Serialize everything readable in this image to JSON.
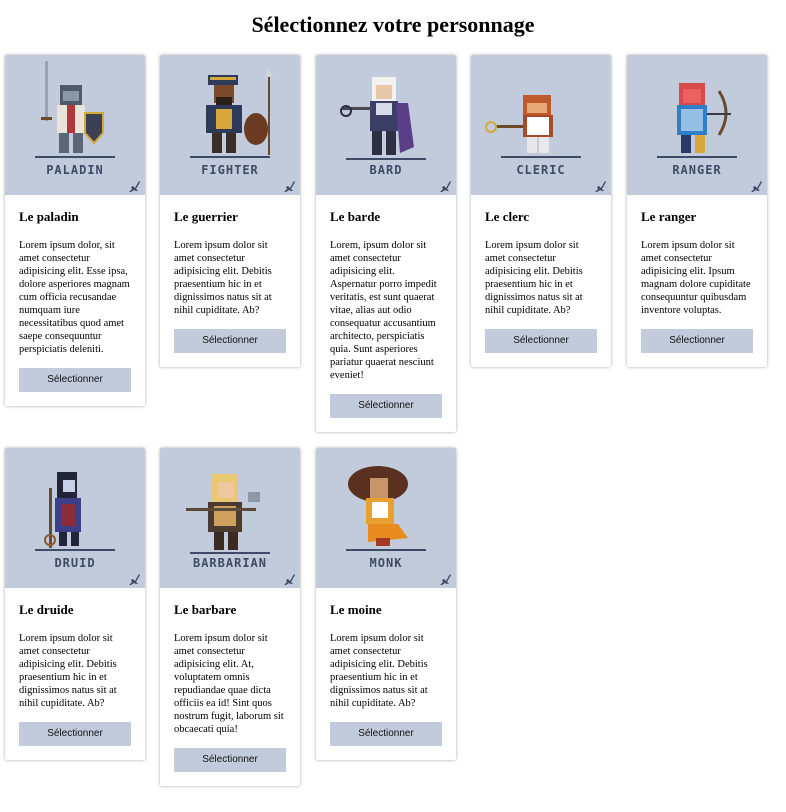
{
  "page": {
    "title": "Sélectionnez votre personnage"
  },
  "colors": {
    "art_bg": "#c2cbdb",
    "button_bg": "#c2cbdb",
    "accent": "#3f4a66"
  },
  "cards": [
    {
      "class_label": "PALADIN",
      "title": "Le paladin",
      "description": "Lorem ipsum dolor, sit amet consectetur adipisicing elit. Esse ipsa, dolore asperiores magnam cum officia recusandae numquam iure necessitatibus quod amet saepe consequuntur perspiciatis deleniti.",
      "button": "Sélectionner",
      "icon": "paladin-figure-icon"
    },
    {
      "class_label": "FIGHTER",
      "title": "Le guerrier",
      "description": "Lorem ipsum dolor sit amet consectetur adipisicing elit. Debitis praesentium hic in et dignissimos natus sit at nihil cupiditate. Ab?",
      "button": "Sélectionner",
      "icon": "fighter-figure-icon"
    },
    {
      "class_label": "BARD",
      "title": "Le barde",
      "description": "Lorem, ipsum dolor sit amet consectetur adipisicing elit. Aspernatur porro impedit veritatis, est sunt quaerat vitae, alias aut odio consequatur accusantium architecto, perspiciatis quia. Sunt asperiores pariatur quaerat nesciunt eveniet!",
      "button": "Sélectionner",
      "icon": "bard-figure-icon"
    },
    {
      "class_label": "CLERIC",
      "title": "Le clerc",
      "description": "Lorem ipsum dolor sit amet consectetur adipisicing elit. Debitis praesentium hic in et dignissimos natus sit at nihil cupiditate. Ab?",
      "button": "Sélectionner",
      "icon": "cleric-figure-icon"
    },
    {
      "class_label": "RANGER",
      "title": "Le ranger",
      "description": "Lorem ipsum dolor sit amet consectetur adipisicing elit. Ipsum magnam dolore cupiditate consequuntur quibusdam inventore voluptas.",
      "button": "Sélectionner",
      "icon": "ranger-figure-icon"
    },
    {
      "class_label": "DRUID",
      "title": "Le druide",
      "description": "Lorem ipsum dolor sit amet consectetur adipisicing elit. Debitis praesentium hic in et dignissimos natus sit at nihil cupiditate. Ab?",
      "button": "Sélectionner",
      "icon": "druid-figure-icon"
    },
    {
      "class_label": "BARBARIAN",
      "title": "Le barbare",
      "description": "Lorem ipsum dolor sit amet consectetur adipisicing elit. At, voluptatem omnis repudiandae quae dicta officiis ea id! Sint quos nostrum fugit, laborum sit obcaecati quia!",
      "button": "Sélectionner",
      "icon": "barbarian-figure-icon"
    },
    {
      "class_label": "MONK",
      "title": "Le moine",
      "description": "Lorem ipsum dolor sit amet consectetur adipisicing elit. Debitis praesentium hic in et dignissimos natus sit at nihil cupiditate. Ab?",
      "button": "Sélectionner",
      "icon": "monk-figure-icon"
    }
  ]
}
